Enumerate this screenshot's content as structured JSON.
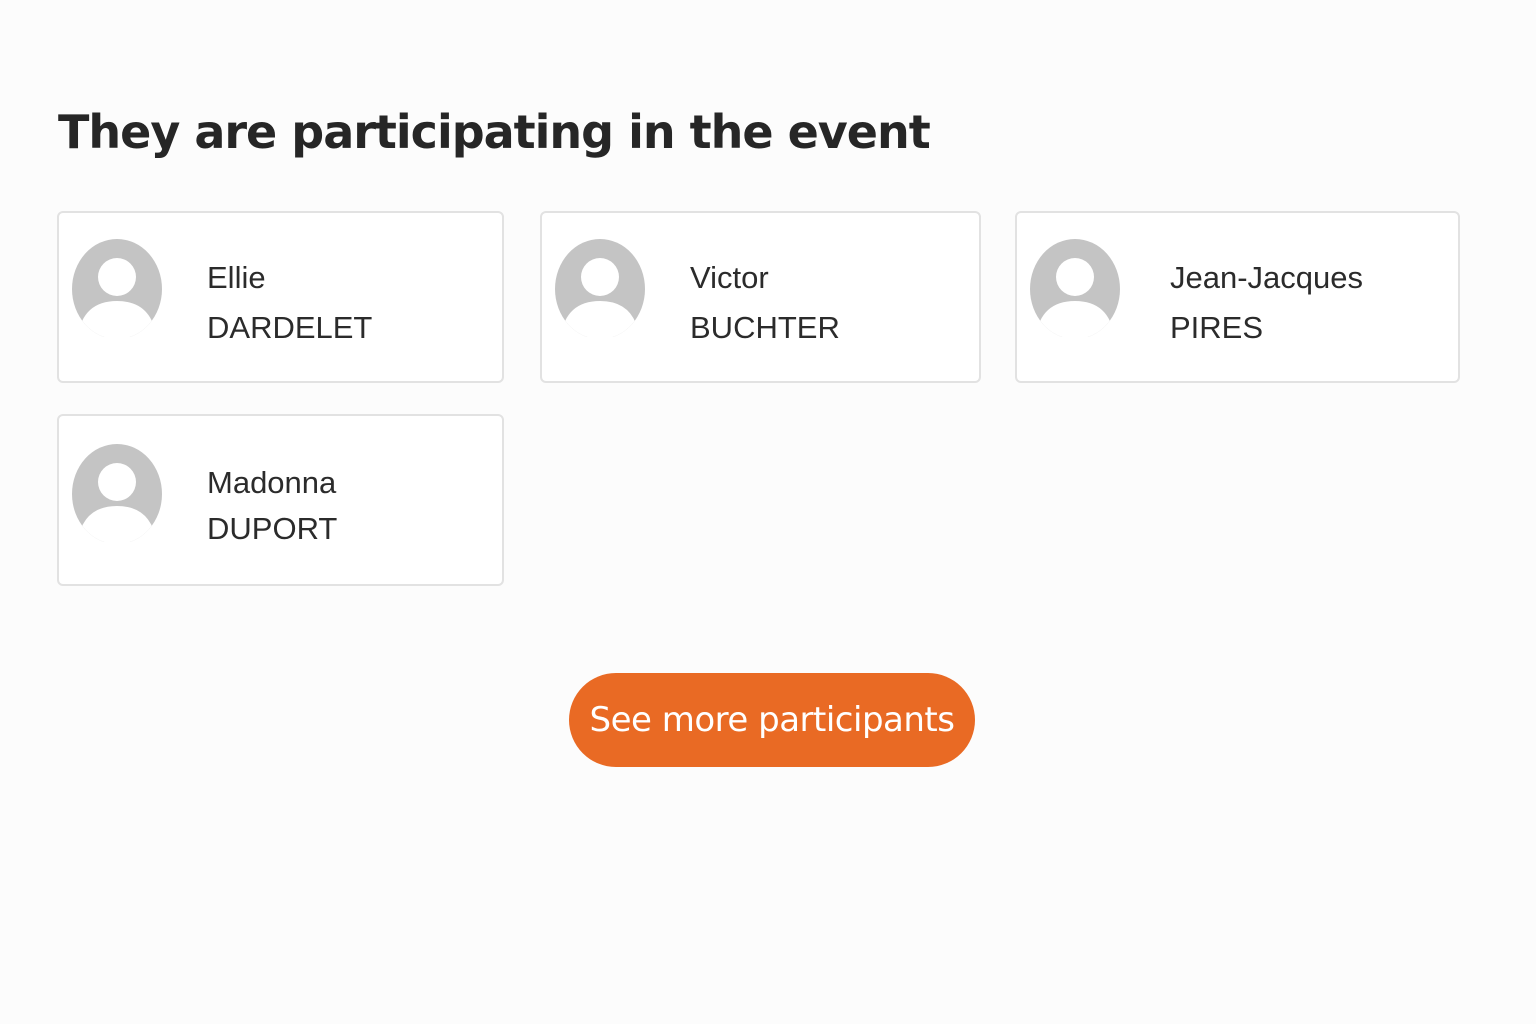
{
  "section": {
    "title": "They are participating in the event"
  },
  "participants": [
    {
      "first_name": "Ellie",
      "last_name": "DARDELET",
      "avatar_icon": "default-user-avatar-icon"
    },
    {
      "first_name": "Victor",
      "last_name": "BUCHTER",
      "avatar_icon": "default-user-avatar-icon"
    },
    {
      "first_name": "Jean-Jacques",
      "last_name": "PIRES",
      "avatar_icon": "default-user-avatar-icon"
    },
    {
      "first_name": "Madonna",
      "last_name": "DUPORT",
      "avatar_icon": "default-user-avatar-icon"
    }
  ],
  "see_more": {
    "label": "See more participants"
  },
  "colors": {
    "accent": "#e96a24",
    "avatar_gray": "#c4c4c4",
    "card_border": "#e2e2e2",
    "text": "#262626"
  }
}
